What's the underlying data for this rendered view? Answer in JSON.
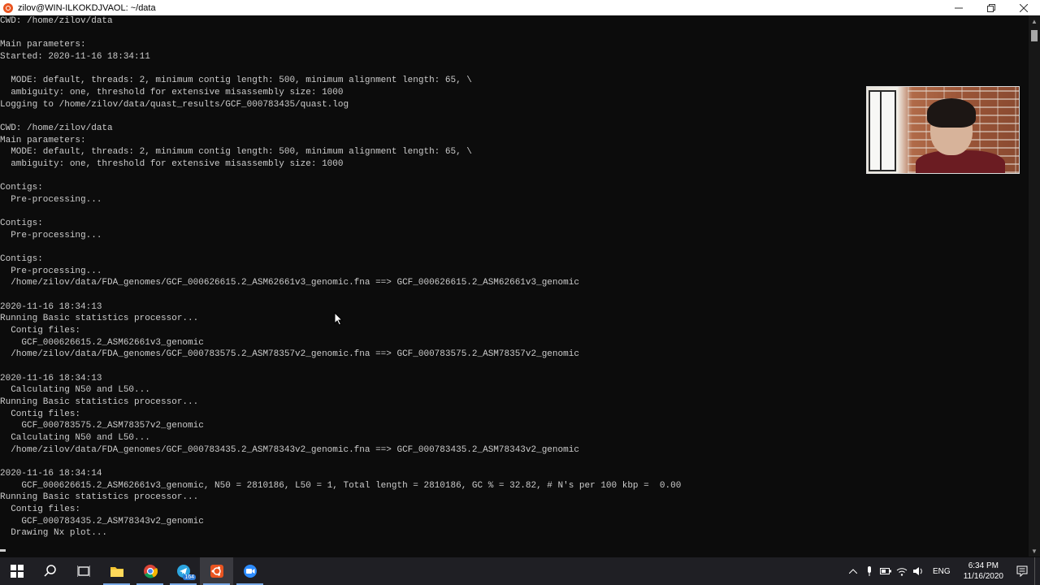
{
  "window": {
    "title": "zilov@WIN-ILKOKDJVAOL: ~/data",
    "minimize_label": "—",
    "maximize_label": "❐",
    "close_label": "✕"
  },
  "terminal": {
    "lines": [
      "CWD: /home/zilov/data",
      "",
      "Main parameters:",
      "Started: 2020-11-16 18:34:11",
      "",
      "  MODE: default, threads: 2, minimum contig length: 500, minimum alignment length: 65, \\",
      "  ambiguity: one, threshold for extensive misassembly size: 1000",
      "Logging to /home/zilov/data/quast_results/GCF_000783435/quast.log",
      "",
      "CWD: /home/zilov/data",
      "Main parameters:",
      "  MODE: default, threads: 2, minimum contig length: 500, minimum alignment length: 65, \\",
      "  ambiguity: one, threshold for extensive misassembly size: 1000",
      "",
      "Contigs:",
      "  Pre-processing...",
      "",
      "Contigs:",
      "  Pre-processing...",
      "",
      "Contigs:",
      "  Pre-processing...",
      "  /home/zilov/data/FDA_genomes/GCF_000626615.2_ASM62661v3_genomic.fna ==> GCF_000626615.2_ASM62661v3_genomic",
      "",
      "2020-11-16 18:34:13",
      "Running Basic statistics processor...",
      "  Contig files:",
      "    GCF_000626615.2_ASM62661v3_genomic",
      "  /home/zilov/data/FDA_genomes/GCF_000783575.2_ASM78357v2_genomic.fna ==> GCF_000783575.2_ASM78357v2_genomic",
      "",
      "2020-11-16 18:34:13",
      "  Calculating N50 and L50...",
      "Running Basic statistics processor...",
      "  Contig files:",
      "    GCF_000783575.2_ASM78357v2_genomic",
      "  Calculating N50 and L50...",
      "  /home/zilov/data/FDA_genomes/GCF_000783435.2_ASM78343v2_genomic.fna ==> GCF_000783435.2_ASM78343v2_genomic",
      "",
      "2020-11-16 18:34:14",
      "    GCF_000626615.2_ASM62661v3_genomic, N50 = 2810186, L50 = 1, Total length = 2810186, GC % = 32.82, # N's per 100 kbp =  0.00",
      "Running Basic statistics processor...",
      "  Contig files:",
      "    GCF_000783435.2_ASM78343v2_genomic",
      "  Drawing Nx plot..."
    ]
  },
  "taskbar": {
    "apps": [
      {
        "name": "start-button",
        "icon": "windows-logo-icon"
      },
      {
        "name": "search-button",
        "icon": "search-icon"
      },
      {
        "name": "task-view-button",
        "icon": "task-view-icon"
      },
      {
        "name": "file-explorer-button",
        "icon": "folder-icon"
      },
      {
        "name": "chrome-button",
        "icon": "chrome-icon"
      },
      {
        "name": "telegram-button",
        "icon": "telegram-icon",
        "badge": "164"
      },
      {
        "name": "ubuntu-button",
        "icon": "ubuntu-icon"
      },
      {
        "name": "zoom-button",
        "icon": "zoom-icon"
      }
    ],
    "telegram_badge": "164",
    "language": "ENG",
    "time": "6:34 PM",
    "date": "11/16/2020"
  },
  "colors": {
    "terminal_bg": "#0c0c0c",
    "terminal_fg": "#cccccc",
    "taskbar_bg": "#1f1f24",
    "ubuntu_orange": "#e95420"
  }
}
